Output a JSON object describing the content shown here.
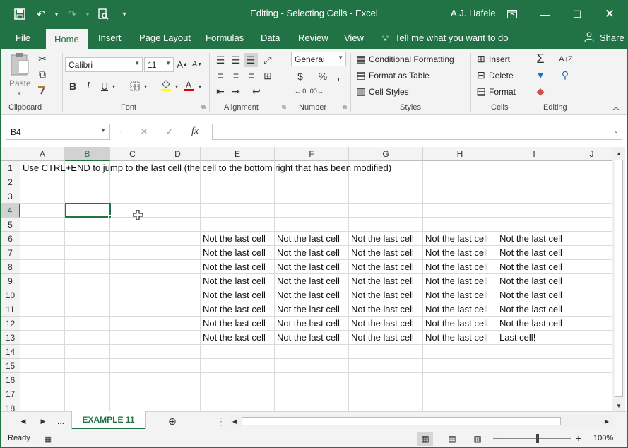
{
  "window": {
    "title": "Editing - Selecting Cells  -  Excel",
    "user": "A.J. Hafele",
    "brand_color": "#217346"
  },
  "qat": [
    "save-icon",
    "undo-icon",
    "redo-icon",
    "print-preview-icon",
    "customize-icon"
  ],
  "tabs": [
    "File",
    "Home",
    "Insert",
    "Page Layout",
    "Formulas",
    "Data",
    "Review",
    "View"
  ],
  "tell_me": "Tell me what you want to do",
  "share": "Share",
  "ribbon": {
    "clipboard": {
      "paste": "Paste",
      "label": "Clipboard"
    },
    "font": {
      "name": "Calibri",
      "size": "11",
      "bold": "B",
      "italic": "I",
      "underline": "U",
      "label": "Font"
    },
    "alignment": {
      "label": "Alignment"
    },
    "number": {
      "format": "General",
      "currency": "$",
      "percent": "%",
      "comma": ",",
      "label": "Number"
    },
    "styles": {
      "conditional": "Conditional Formatting",
      "table": "Format as Table",
      "cell": "Cell Styles",
      "label": "Styles"
    },
    "cells": {
      "insert": "Insert",
      "delete": "Delete",
      "format": "Format",
      "label": "Cells"
    },
    "editing": {
      "label": "Editing"
    }
  },
  "formula_bar": {
    "name_box": "B4",
    "fx": "fx",
    "value": ""
  },
  "columns": [
    "A",
    "B",
    "C",
    "D",
    "E",
    "F",
    "G",
    "H",
    "I",
    "J"
  ],
  "rows": [
    "1",
    "2",
    "3",
    "4",
    "5",
    "6",
    "7",
    "8",
    "9",
    "10",
    "11",
    "12",
    "13",
    "14",
    "15",
    "16",
    "17",
    "18"
  ],
  "cells": {
    "a1": "Use CTRL+END to jump to the last cell (the cell to the bottom right that has been modified)",
    "repeat_text": "Not the last cell",
    "last_cell": "Last cell!"
  },
  "sheet_tabs": {
    "more": "...",
    "active": "EXAMPLE 11"
  },
  "status": {
    "ready": "Ready",
    "zoom": "100%"
  }
}
